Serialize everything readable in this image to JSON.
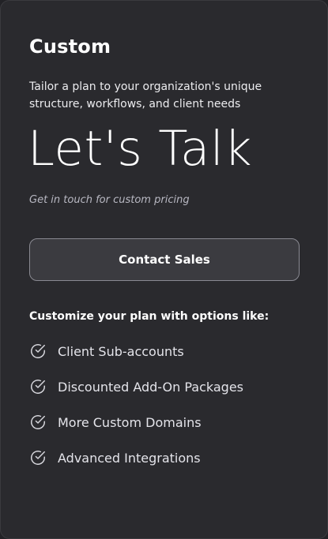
{
  "plan": {
    "name": "Custom",
    "description": "Tailor a plan to your organization's unique structure, workflows, and client needs",
    "price": "Let's Talk",
    "price_note": "Get in touch for custom pricing",
    "cta_label": "Contact Sales"
  },
  "features": {
    "heading": "Customize your plan with options like:",
    "icon": "check-circle-icon",
    "items": [
      {
        "label": "Client Sub-accounts"
      },
      {
        "label": "Discounted Add-On Packages"
      },
      {
        "label": "More Custom Domains"
      },
      {
        "label": "Advanced Integrations"
      }
    ]
  },
  "colors": {
    "background": "#2a2a2e",
    "button_bg": "#3b3b40",
    "button_border": "#8a8a92",
    "text": "#ffffff",
    "muted_text": "#b8b8c2"
  }
}
